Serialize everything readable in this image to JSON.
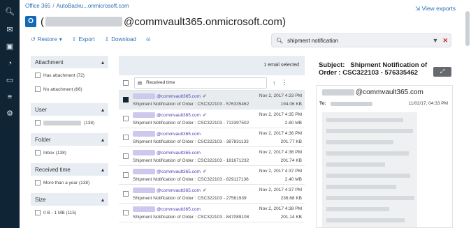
{
  "nav": {
    "icons": [
      "search-icon",
      "inbox-icon",
      "briefcase-icon",
      "gauge-icon",
      "monitor-icon",
      "sliders-icon",
      "settings-icon"
    ]
  },
  "breadcrumb": {
    "items": [
      "Office 365",
      "AutoBacku...onmicrosoft.com"
    ]
  },
  "header": {
    "mailbox_domain": "@commvault365.onmicrosoft.com)",
    "open_paren": "(",
    "view_exports": "View exports"
  },
  "toolbar": {
    "restore": "Restore",
    "export": "Export",
    "download": "Download"
  },
  "search": {
    "value": "shipment notification"
  },
  "filters": [
    {
      "title": "Attachment",
      "items": [
        {
          "label": "Has attachment (72)"
        },
        {
          "label": "No attachment (66)"
        }
      ]
    },
    {
      "title": "User",
      "items": [
        {
          "label": "(138)"
        }
      ]
    },
    {
      "title": "Folder",
      "items": [
        {
          "label": "Inbox (138)"
        }
      ]
    },
    {
      "title": "Received time",
      "items": [
        {
          "label": "More than a year (138)"
        }
      ]
    },
    {
      "title": "Size",
      "items": [
        {
          "label": "0 B - 1 MB (115)"
        }
      ]
    }
  ],
  "list": {
    "count_label": "1 email selected",
    "sort_label": "Received time",
    "rows": [
      {
        "from": "@commvault365.com",
        "subject": "Shipment Notification of Order : CSC322103 - 576335462",
        "date": "Nov 2, 2017 4:33 PM",
        "size": "194.06 KB",
        "selected": true,
        "attach": true
      },
      {
        "from": "@commvault365.com",
        "subject": "Shipment Notification of Order : CSC322103 - 713397502",
        "date": "Nov 2, 2017 4:35 PM",
        "size": "2.80 MB",
        "selected": false,
        "attach": true
      },
      {
        "from": "@commvault365.com",
        "subject": "Shipment Notification of Order : CSC322103 - 387831133",
        "date": "Nov 2, 2017 4:36 PM",
        "size": "201.77 KB",
        "selected": false,
        "attach": false
      },
      {
        "from": "@commvault365.com",
        "subject": "Shipment Notification of Order : CSC322103 - 181671232",
        "date": "Nov 2, 2017 4:36 PM",
        "size": "201.74 KB",
        "selected": false,
        "attach": false
      },
      {
        "from": "@commvault365.com",
        "subject": "Shipment Notification of Order : CSC322103 - 829117136",
        "date": "Nov 2, 2017 4:37 PM",
        "size": "2.40 MB",
        "selected": false,
        "attach": true
      },
      {
        "from": "@commvault365.com",
        "subject": "Shipment Notification of Order : CSC322103 - 27561939",
        "date": "Nov 2, 2017 4:37 PM",
        "size": "236.68 KB",
        "selected": false,
        "attach": true
      },
      {
        "from": "@commvault365.com",
        "subject": "Shipment Notification of Order : CSC322103 - 847089108",
        "date": "Nov 2, 2017 4:38 PM",
        "size": "201.14 KB",
        "selected": false,
        "attach": false
      }
    ]
  },
  "preview": {
    "subject_label": "Subject:",
    "subject": "Shipment Notification of Order : CSC322103 - 576335462",
    "from": "@commvault365.com",
    "to_label": "To:",
    "date": "11/02/17, 04:33 PM"
  },
  "colors": {
    "rail": "#0f2434",
    "link": "#2d6fb5",
    "panel_header": "#e7edf3",
    "sender": "#4a3fb5",
    "danger": "#c62828"
  }
}
